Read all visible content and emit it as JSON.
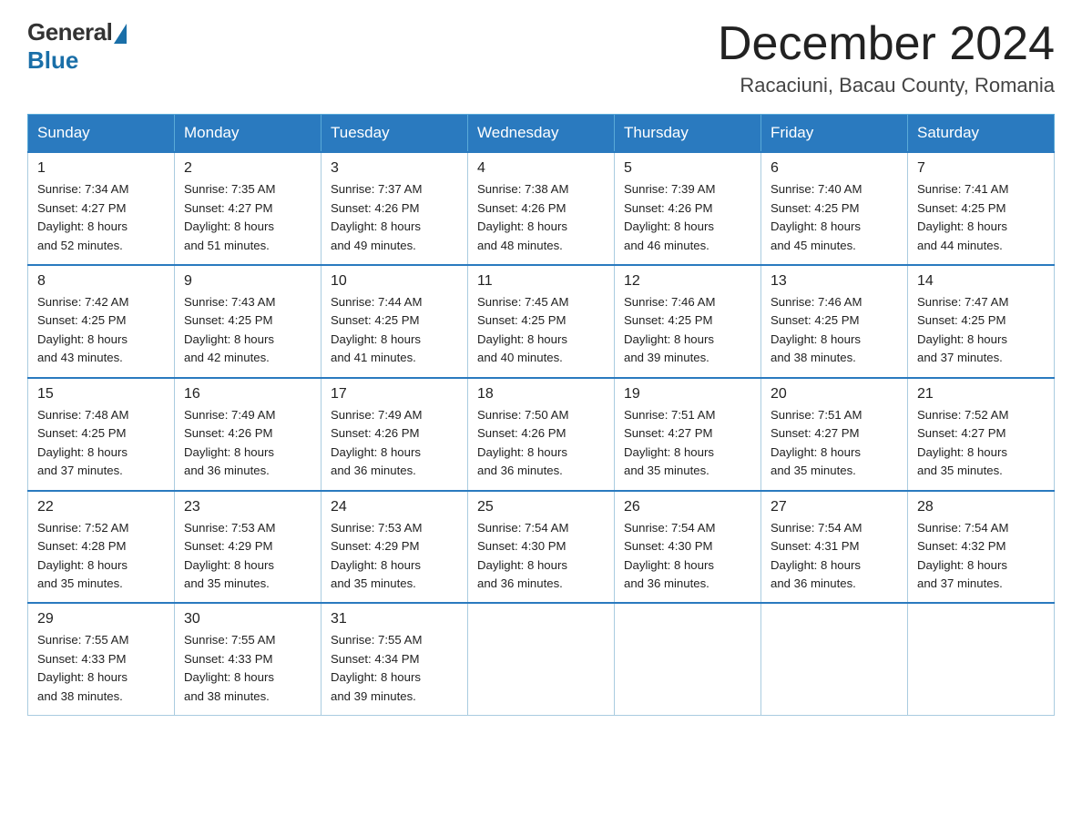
{
  "logo": {
    "general": "General",
    "blue": "Blue"
  },
  "title": "December 2024",
  "location": "Racaciuni, Bacau County, Romania",
  "days_of_week": [
    "Sunday",
    "Monday",
    "Tuesday",
    "Wednesday",
    "Thursday",
    "Friday",
    "Saturday"
  ],
  "weeks": [
    [
      {
        "day": "1",
        "sunrise": "7:34 AM",
        "sunset": "4:27 PM",
        "daylight": "8 hours and 52 minutes."
      },
      {
        "day": "2",
        "sunrise": "7:35 AM",
        "sunset": "4:27 PM",
        "daylight": "8 hours and 51 minutes."
      },
      {
        "day": "3",
        "sunrise": "7:37 AM",
        "sunset": "4:26 PM",
        "daylight": "8 hours and 49 minutes."
      },
      {
        "day": "4",
        "sunrise": "7:38 AM",
        "sunset": "4:26 PM",
        "daylight": "8 hours and 48 minutes."
      },
      {
        "day": "5",
        "sunrise": "7:39 AM",
        "sunset": "4:26 PM",
        "daylight": "8 hours and 46 minutes."
      },
      {
        "day": "6",
        "sunrise": "7:40 AM",
        "sunset": "4:25 PM",
        "daylight": "8 hours and 45 minutes."
      },
      {
        "day": "7",
        "sunrise": "7:41 AM",
        "sunset": "4:25 PM",
        "daylight": "8 hours and 44 minutes."
      }
    ],
    [
      {
        "day": "8",
        "sunrise": "7:42 AM",
        "sunset": "4:25 PM",
        "daylight": "8 hours and 43 minutes."
      },
      {
        "day": "9",
        "sunrise": "7:43 AM",
        "sunset": "4:25 PM",
        "daylight": "8 hours and 42 minutes."
      },
      {
        "day": "10",
        "sunrise": "7:44 AM",
        "sunset": "4:25 PM",
        "daylight": "8 hours and 41 minutes."
      },
      {
        "day": "11",
        "sunrise": "7:45 AM",
        "sunset": "4:25 PM",
        "daylight": "8 hours and 40 minutes."
      },
      {
        "day": "12",
        "sunrise": "7:46 AM",
        "sunset": "4:25 PM",
        "daylight": "8 hours and 39 minutes."
      },
      {
        "day": "13",
        "sunrise": "7:46 AM",
        "sunset": "4:25 PM",
        "daylight": "8 hours and 38 minutes."
      },
      {
        "day": "14",
        "sunrise": "7:47 AM",
        "sunset": "4:25 PM",
        "daylight": "8 hours and 37 minutes."
      }
    ],
    [
      {
        "day": "15",
        "sunrise": "7:48 AM",
        "sunset": "4:25 PM",
        "daylight": "8 hours and 37 minutes."
      },
      {
        "day": "16",
        "sunrise": "7:49 AM",
        "sunset": "4:26 PM",
        "daylight": "8 hours and 36 minutes."
      },
      {
        "day": "17",
        "sunrise": "7:49 AM",
        "sunset": "4:26 PM",
        "daylight": "8 hours and 36 minutes."
      },
      {
        "day": "18",
        "sunrise": "7:50 AM",
        "sunset": "4:26 PM",
        "daylight": "8 hours and 36 minutes."
      },
      {
        "day": "19",
        "sunrise": "7:51 AM",
        "sunset": "4:27 PM",
        "daylight": "8 hours and 35 minutes."
      },
      {
        "day": "20",
        "sunrise": "7:51 AM",
        "sunset": "4:27 PM",
        "daylight": "8 hours and 35 minutes."
      },
      {
        "day": "21",
        "sunrise": "7:52 AM",
        "sunset": "4:27 PM",
        "daylight": "8 hours and 35 minutes."
      }
    ],
    [
      {
        "day": "22",
        "sunrise": "7:52 AM",
        "sunset": "4:28 PM",
        "daylight": "8 hours and 35 minutes."
      },
      {
        "day": "23",
        "sunrise": "7:53 AM",
        "sunset": "4:29 PM",
        "daylight": "8 hours and 35 minutes."
      },
      {
        "day": "24",
        "sunrise": "7:53 AM",
        "sunset": "4:29 PM",
        "daylight": "8 hours and 35 minutes."
      },
      {
        "day": "25",
        "sunrise": "7:54 AM",
        "sunset": "4:30 PM",
        "daylight": "8 hours and 36 minutes."
      },
      {
        "day": "26",
        "sunrise": "7:54 AM",
        "sunset": "4:30 PM",
        "daylight": "8 hours and 36 minutes."
      },
      {
        "day": "27",
        "sunrise": "7:54 AM",
        "sunset": "4:31 PM",
        "daylight": "8 hours and 36 minutes."
      },
      {
        "day": "28",
        "sunrise": "7:54 AM",
        "sunset": "4:32 PM",
        "daylight": "8 hours and 37 minutes."
      }
    ],
    [
      {
        "day": "29",
        "sunrise": "7:55 AM",
        "sunset": "4:33 PM",
        "daylight": "8 hours and 38 minutes."
      },
      {
        "day": "30",
        "sunrise": "7:55 AM",
        "sunset": "4:33 PM",
        "daylight": "8 hours and 38 minutes."
      },
      {
        "day": "31",
        "sunrise": "7:55 AM",
        "sunset": "4:34 PM",
        "daylight": "8 hours and 39 minutes."
      },
      null,
      null,
      null,
      null
    ]
  ],
  "labels": {
    "sunrise": "Sunrise:",
    "sunset": "Sunset:",
    "daylight": "Daylight:"
  }
}
